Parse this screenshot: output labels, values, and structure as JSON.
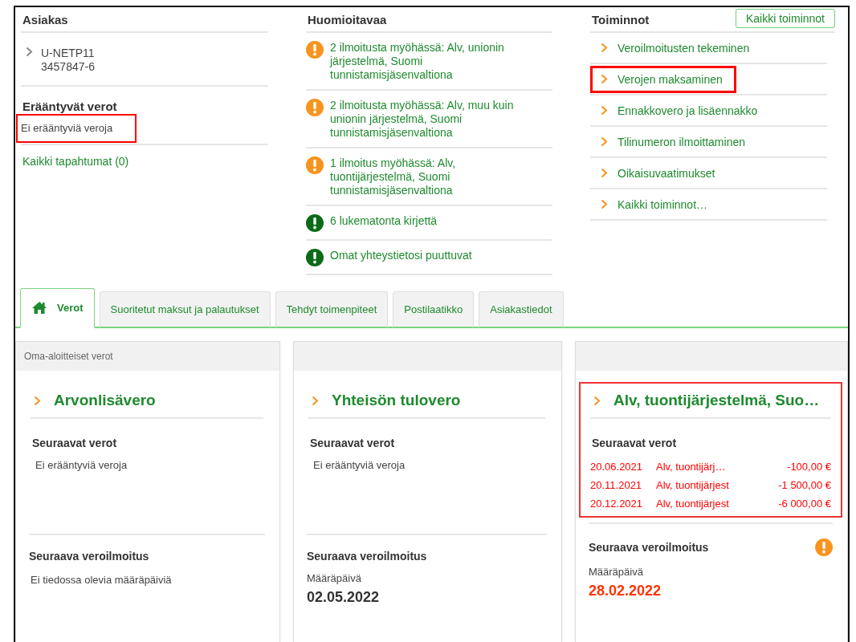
{
  "customer": {
    "heading": "Asiakas",
    "id": "U-NETP11",
    "number": "3457847-6",
    "due_heading": "Erääntyvät verot",
    "due_text": "Ei erääntyviä veroja",
    "due_highlighted": true,
    "events_link": "Kaikki tapahtumat (0)"
  },
  "notices": {
    "heading": "Huomioitavaa",
    "items": [
      {
        "text": "2 ilmoitusta myöhässä: Alv, unionin järjestelmä, Suomi tunnistamisjäsenvaltiona",
        "kind": "warning"
      },
      {
        "text": "2 ilmoitusta myöhässä: Alv, muu kuin unionin järjestelmä, Suomi tunnistamisjäsenvaltiona",
        "kind": "warning"
      },
      {
        "text": "1 ilmoitus myöhässä: Alv, tuontijärjestelmä, Suomi tunnistamisjäsenvaltiona",
        "kind": "warning"
      },
      {
        "text": "6 lukematonta kirjettä",
        "kind": "info"
      },
      {
        "text": "Omat yhteystietosi puuttuvat",
        "kind": "info"
      }
    ]
  },
  "actions": {
    "heading": "Toiminnot",
    "all_button": "Kaikki toiminnot",
    "items": [
      {
        "label": "Veroilmoitusten tekeminen",
        "highlighted": false
      },
      {
        "label": "Verojen maksaminen",
        "highlighted": true
      },
      {
        "label": "Ennakkovero ja lisäennakko",
        "highlighted": false
      },
      {
        "label": "Tilinumeron ilmoittaminen",
        "highlighted": false
      },
      {
        "label": "Oikaisuvaatimukset",
        "highlighted": false
      },
      {
        "label": "Kaikki toiminnot…",
        "highlighted": false
      }
    ]
  },
  "tabs": [
    {
      "label": "Verot",
      "selected": true
    },
    {
      "label": "Suoritetut maksut ja palautukset",
      "selected": false
    },
    {
      "label": "Tehdyt toimenpiteet",
      "selected": false
    },
    {
      "label": "Postilaatikko",
      "selected": false
    },
    {
      "label": "Asiakastiedot",
      "selected": false
    }
  ],
  "cards": [
    {
      "header": "Oma-aloitteiset verot",
      "title": "Arvonlisävero",
      "highlighted": false,
      "upcoming_heading": "Seuraavat verot",
      "upcoming_empty": "Ei erääntyviä veroja",
      "filing_heading": "Seuraava veroilmoitus",
      "filing_empty": "Ei tiedossa olevia määräpäiviä",
      "warning": false
    },
    {
      "title": "Yhteisön tulovero",
      "highlighted": false,
      "upcoming_heading": "Seuraavat verot",
      "upcoming_empty": "Ei erääntyviä veroja",
      "filing_heading": "Seuraava veroilmoitus",
      "due_label": "Määräpäivä",
      "due_date": "02.05.2022",
      "overdue": false,
      "warning": false
    },
    {
      "title": "Alv, tuontijärjestelmä, Suo…",
      "highlighted": true,
      "upcoming_heading": "Seuraavat verot",
      "upcoming_rows": [
        {
          "date": "20.06.2021",
          "name": "Alv, tuontijärj…",
          "amount": "-100,00 €"
        },
        {
          "date": "20.11.2021",
          "name": "Alv, tuontijärjest",
          "amount": "-1 500,00 €"
        },
        {
          "date": "20.12.2021",
          "name": "Alv, tuontijärjest",
          "amount": "-6 000,00 €"
        }
      ],
      "filing_heading": "Seuraava veroilmoitus",
      "due_label": "Määräpäivä",
      "due_date": "28.02.2022",
      "overdue": true,
      "warning": true
    }
  ]
}
